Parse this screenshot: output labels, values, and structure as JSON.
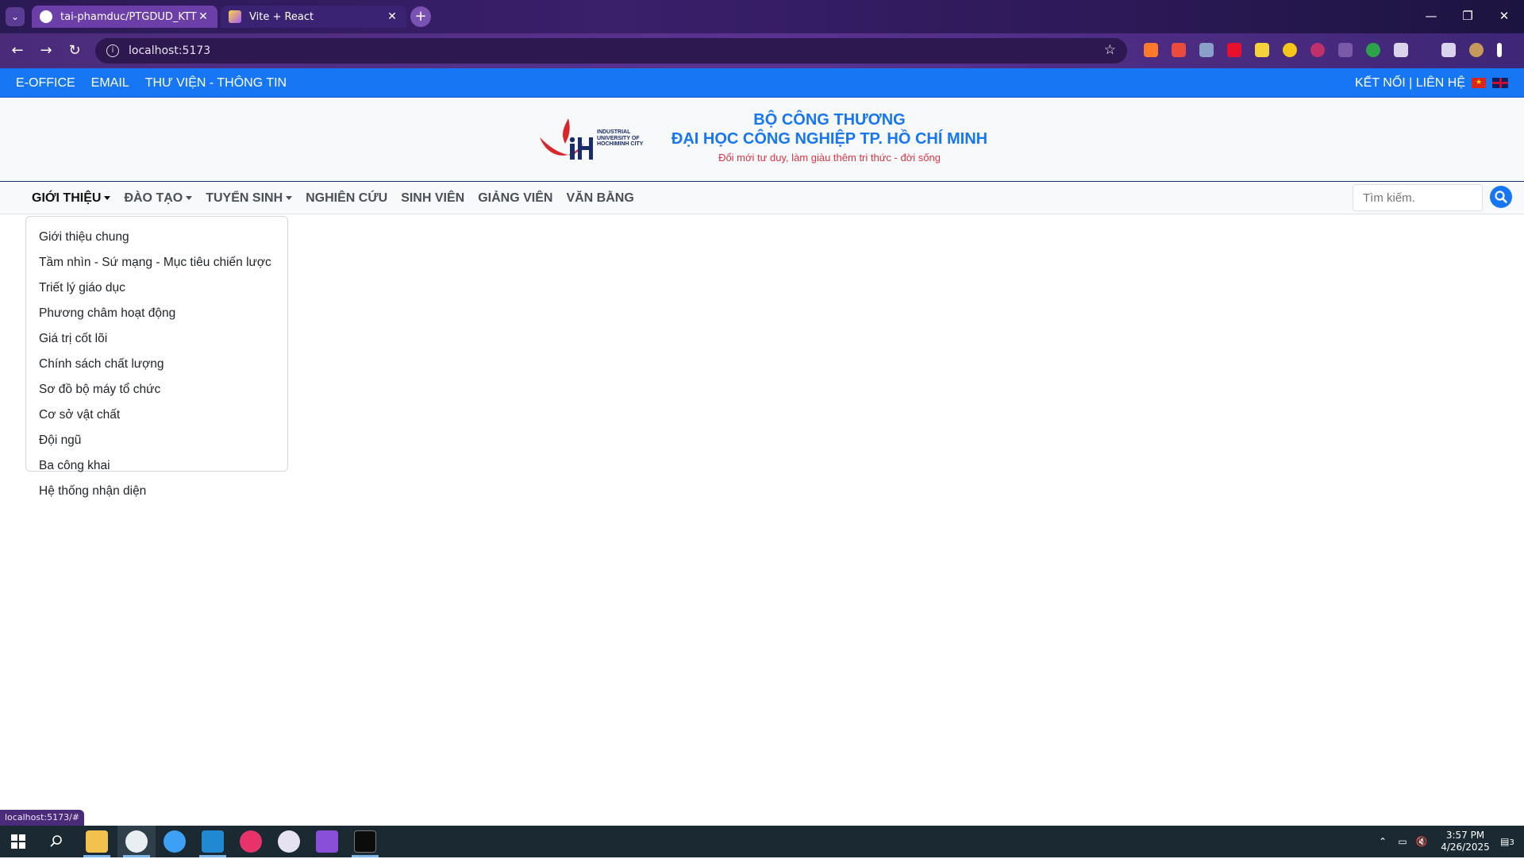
{
  "browser": {
    "tabs": [
      {
        "title": "tai-phamduc/PTGDUD_KTTHCK",
        "active": false
      },
      {
        "title": "Vite + React",
        "active": true
      }
    ],
    "url": "localhost:5173",
    "status_url": "localhost:5173/#",
    "icons": [
      "tab-search-icon",
      "back-icon",
      "forward-icon",
      "reload-icon",
      "info-icon",
      "star-icon",
      "new-tab-icon",
      "minimize-icon",
      "restore-icon",
      "close-icon"
    ]
  },
  "topbar": {
    "links": [
      "E-OFFICE",
      "EMAIL",
      "THƯ VIỆN - THÔNG TIN"
    ],
    "right_text": "KẾT NỐI | LIÊN HỆ",
    "bg_color": "#1676f3"
  },
  "header": {
    "logo_text": [
      "INDUSTRIAL",
      "UNIVERSITY OF",
      "HOCHIMINH CITY"
    ],
    "title_line1": "BỘ CÔNG THƯƠNG",
    "title_line2": "ĐẠI HỌC CÔNG NGHIỆP TP. HỒ CHÍ MINH",
    "slogan": "Đổi mới tư duy, làm giàu thêm tri thức - đời sống"
  },
  "nav": {
    "items": [
      {
        "label": "GIỚI THIỆU",
        "dropdown": true
      },
      {
        "label": "ĐÀO TẠO",
        "dropdown": true
      },
      {
        "label": "TUYỂN SINH",
        "dropdown": true
      },
      {
        "label": "NGHIÊN CỨU",
        "dropdown": false
      },
      {
        "label": "SINH VIÊN",
        "dropdown": false
      },
      {
        "label": "GIẢNG VIÊN",
        "dropdown": false
      },
      {
        "label": "VĂN BẰNG",
        "dropdown": false
      }
    ],
    "search_placeholder": "Tìm kiếm."
  },
  "dropdown": {
    "items": [
      "Giới thiệu chung",
      "Tầm nhìn - Sứ mạng - Mục tiêu chiến lược",
      "Triết lý giáo dục",
      "Phương châm hoạt động",
      "Giá trị cốt lõi",
      "Chính sách chất lượng",
      "Sơ đồ bộ máy tổ chức",
      "Cơ sở vật chất",
      "Đội ngũ",
      "Ba công khai",
      "Hệ thống nhận diện"
    ]
  },
  "taskbar": {
    "time": "3:57 PM",
    "date": "4/26/2025",
    "notification_count": "3"
  }
}
